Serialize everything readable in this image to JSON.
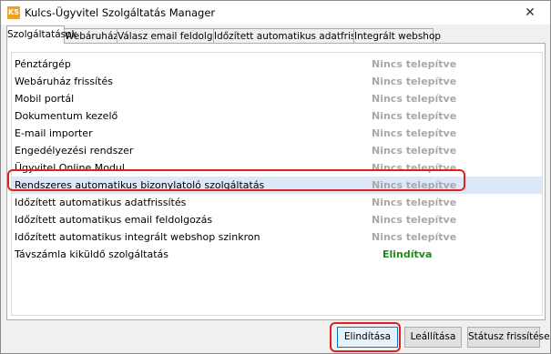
{
  "window": {
    "title": "Kulcs-Ügyvitel Szolgáltatás Manager",
    "icon_text": "KS",
    "close_symbol": "✕"
  },
  "tabs": [
    {
      "label": "Szolgáltatások",
      "active": true
    },
    {
      "label": "Webáruház",
      "active": false
    },
    {
      "label": "Válasz email feldolgozó",
      "active": false
    },
    {
      "label": "Időzített automatikus adatfrissítés",
      "active": false
    },
    {
      "label": "Integrált webshop",
      "active": false
    }
  ],
  "services": [
    {
      "name": "Pénztárgép",
      "status": "Nincs telepítve"
    },
    {
      "name": "Webáruház frissítés",
      "status": "Nincs telepítve"
    },
    {
      "name": "Mobil portál",
      "status": "Nincs telepítve"
    },
    {
      "name": "Dokumentum kezelő",
      "status": "Nincs telepítve"
    },
    {
      "name": "E-mail importer",
      "status": "Nincs telepítve"
    },
    {
      "name": "Engedélyezési rendszer",
      "status": "Nincs telepítve"
    },
    {
      "name": "Ügyvitel Online Modul",
      "status": "Nincs telepítve"
    },
    {
      "name": "Rendszeres automatikus bizonylatoló szolgáltatás",
      "status": "Nincs telepítve",
      "selected": true
    },
    {
      "name": "Időzített automatikus adatfrissítés",
      "status": "Nincs telepítve"
    },
    {
      "name": "Időzített automatikus email feldolgozás",
      "status": "Nincs telepítve"
    },
    {
      "name": "Időzített automatikus integrált webshop szinkron",
      "status": "Nincs telepítve"
    },
    {
      "name": "Távszámla kiküldő szolgáltatás",
      "status": "Elindítva",
      "running": true
    }
  ],
  "buttons": {
    "start": "Elindítása",
    "stop": "Leállítása",
    "refresh": "Státusz frissítése"
  },
  "colors": {
    "status_not_installed": "#a8a8a8",
    "status_running": "#1a8a1a",
    "selection": "#dde8f6",
    "highlight": "#e02020"
  }
}
